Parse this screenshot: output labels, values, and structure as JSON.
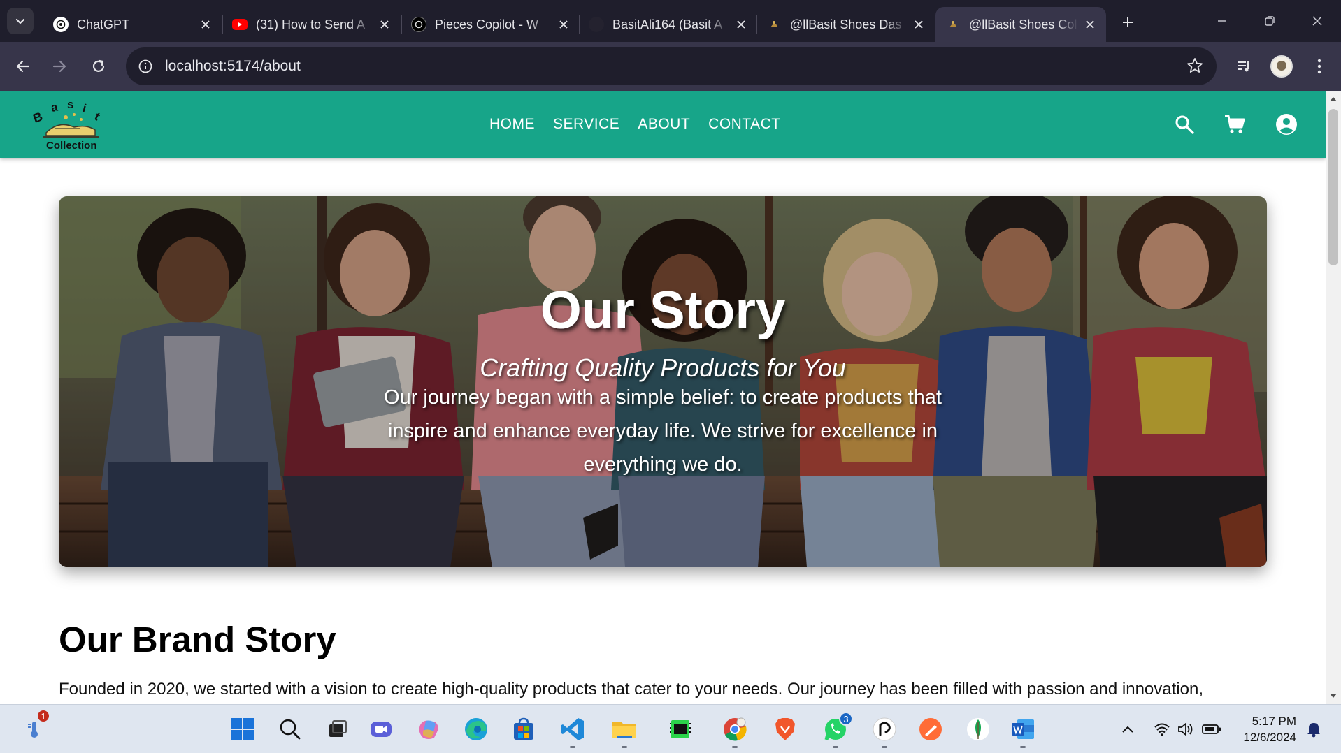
{
  "browser": {
    "tabs": [
      {
        "title": "ChatGPT",
        "favicon": "chatgpt-icon",
        "active": false
      },
      {
        "title": "(31) How to Send A",
        "favicon": "youtube-icon",
        "active": false
      },
      {
        "title": "Pieces Copilot - W",
        "favicon": "pieces-icon",
        "active": false
      },
      {
        "title": "BasitAli164 (Basit A",
        "favicon": "github-icon",
        "active": false
      },
      {
        "title": "@llBasit Shoes Das",
        "favicon": "site-favicon",
        "active": false
      },
      {
        "title": "@llBasit Shoes Col",
        "favicon": "site-favicon",
        "active": true
      }
    ],
    "url": "localhost:5174/about"
  },
  "site": {
    "logo_caption": "Collection",
    "logo_letters": [
      "B",
      "a",
      "s",
      "i",
      "t"
    ],
    "nav": [
      "HOME",
      "SERVICE",
      "ABOUT",
      "CONTACT"
    ],
    "brand_color": "#17a589"
  },
  "hero": {
    "title": "Our Story",
    "subtitle": "Crafting Quality Products for You",
    "body": "Our journey began with a simple belief: to create products that inspire and enhance everyday life. We strive for excellence in everything we do."
  },
  "brand": {
    "title": "Our Brand Story",
    "text": "Founded in 2020, we started with a vision to create high-quality products that cater to your needs. Our journey has been filled with passion and innovation,"
  },
  "taskbar": {
    "weather_badge": "1",
    "whatsapp_badge": "3",
    "time": "5:17 PM",
    "date": "12/6/2024"
  }
}
